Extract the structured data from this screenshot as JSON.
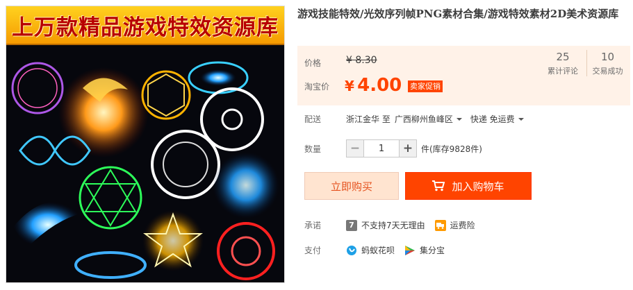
{
  "image": {
    "banner_text": "上万款精品游戏特效资源库"
  },
  "product": {
    "title": "游戏技能特效/光效序列帧PNG素材合集/游戏特效素材2D美术资源库"
  },
  "price": {
    "label": "价格",
    "original": "¥ 8.30",
    "taobao_label": "淘宝价",
    "current_symbol": "¥",
    "current_value": "4.00",
    "promo_tag": "卖家促销"
  },
  "stats": {
    "review_count": "25",
    "review_label": "累计评论",
    "deal_count": "10",
    "deal_label": "交易成功"
  },
  "shipping": {
    "label": "配送",
    "from": "浙江金华 至",
    "to": "广西柳州鱼峰区",
    "method": "快递 免运费"
  },
  "quantity": {
    "label": "数量",
    "minus": "−",
    "value": "1",
    "plus": "+",
    "stock": "件(库存9828件)"
  },
  "actions": {
    "buy_now": "立即购买",
    "add_to_cart": "加入购物车"
  },
  "promise": {
    "label": "承诺",
    "no_reason_icon": "7",
    "no_reason": "不支持7天无理由",
    "freight_insurance": "运费险"
  },
  "payment": {
    "label": "支付",
    "huabei": "蚂蚁花呗",
    "jifenbao": "集分宝"
  },
  "colors": {
    "accent": "#ff4400",
    "price_bg": "#fff2e8",
    "buy_bg": "#ffe4d0"
  }
}
